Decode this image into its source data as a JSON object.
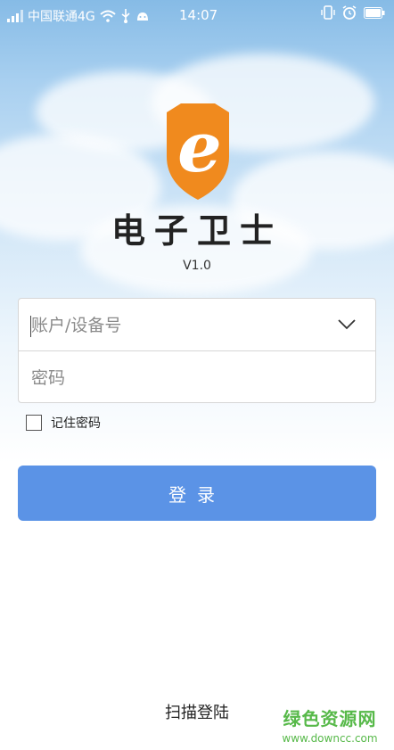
{
  "status_bar": {
    "carrier": "中国联通4G",
    "time": "14:07"
  },
  "app": {
    "name": "电子卫士",
    "version": "V1.0",
    "logo_letter": "e",
    "logo_color": "#f08a1e"
  },
  "login_form": {
    "account_placeholder": "账户/设备号",
    "account_value": "",
    "password_placeholder": "密码",
    "password_value": "",
    "remember_label": "记住密码",
    "remember_checked": false,
    "submit_label": "登录",
    "accent_color": "#5b93e6"
  },
  "footer": {
    "scan_login": "扫描登陆"
  },
  "watermark": {
    "title": "绿色资源网",
    "url": "www.downcc.com"
  }
}
